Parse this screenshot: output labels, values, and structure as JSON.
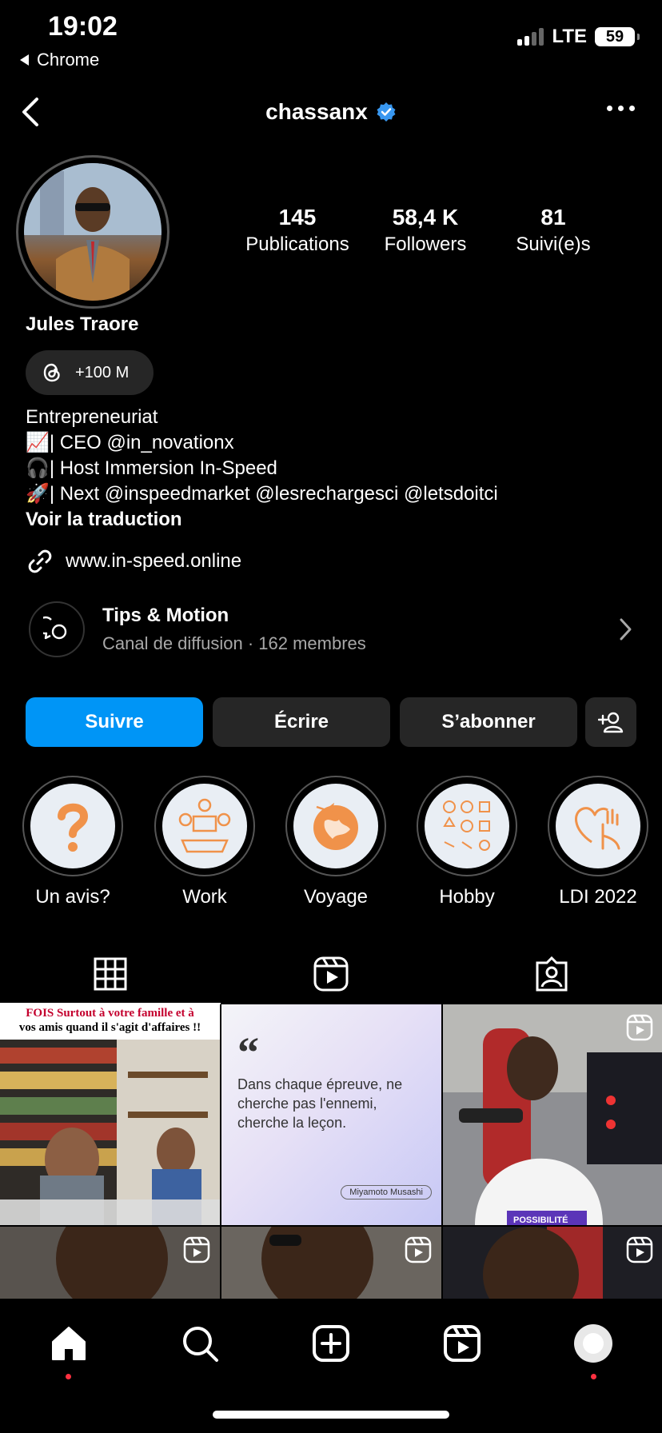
{
  "status_bar": {
    "time": "19:02",
    "back_app": "Chrome",
    "network": "LTE",
    "battery": "59"
  },
  "header": {
    "username": "chassanx",
    "verified": true,
    "more_icon": "more-horizontal-icon",
    "back_icon": "chevron-left-icon"
  },
  "profile": {
    "full_name": "Jules Traore",
    "stats": [
      {
        "value": "145",
        "label": "Publications"
      },
      {
        "value": "58,4 K",
        "label": "Followers"
      },
      {
        "value": "81",
        "label": "Suivi(e)s"
      }
    ],
    "threads_badge": "+100 M",
    "bio": {
      "line1": "Entrepreneuriat",
      "line2": "📈| CEO @in_novationx",
      "line3": "🎧| Host Immersion In-Speed",
      "line4": "🚀| Next @inspeedmarket @lesrechargesci @letsdoitci",
      "translate": "Voir la traduction"
    },
    "link": "www.in-speed.online",
    "channel": {
      "title": "Tips & Motion",
      "subtitle": "Canal de diffusion · 162 membres"
    }
  },
  "actions": {
    "follow": "Suivre",
    "message": "Écrire",
    "subscribe": "S’abonner"
  },
  "highlights": [
    {
      "label": "Un avis?"
    },
    {
      "label": "Work"
    },
    {
      "label": "Voyage"
    },
    {
      "label": "Hobby"
    },
    {
      "label": "LDI 2022"
    }
  ],
  "posts": {
    "post1_caption_top": "FOIS Surtout à votre famille et à",
    "post1_caption": "vos amis quand il s'agit d'affaires !!",
    "post2_quote": "Dans chaque épreuve, ne cherche pas l'ennemi, cherche la leçon.",
    "post2_author": "Miyamoto Musashi",
    "post3_caption": "POSSIBILITÉ"
  },
  "colors": {
    "accent": "#0095f6",
    "background": "#000000",
    "button": "#262626",
    "notification": "#ff3040"
  }
}
